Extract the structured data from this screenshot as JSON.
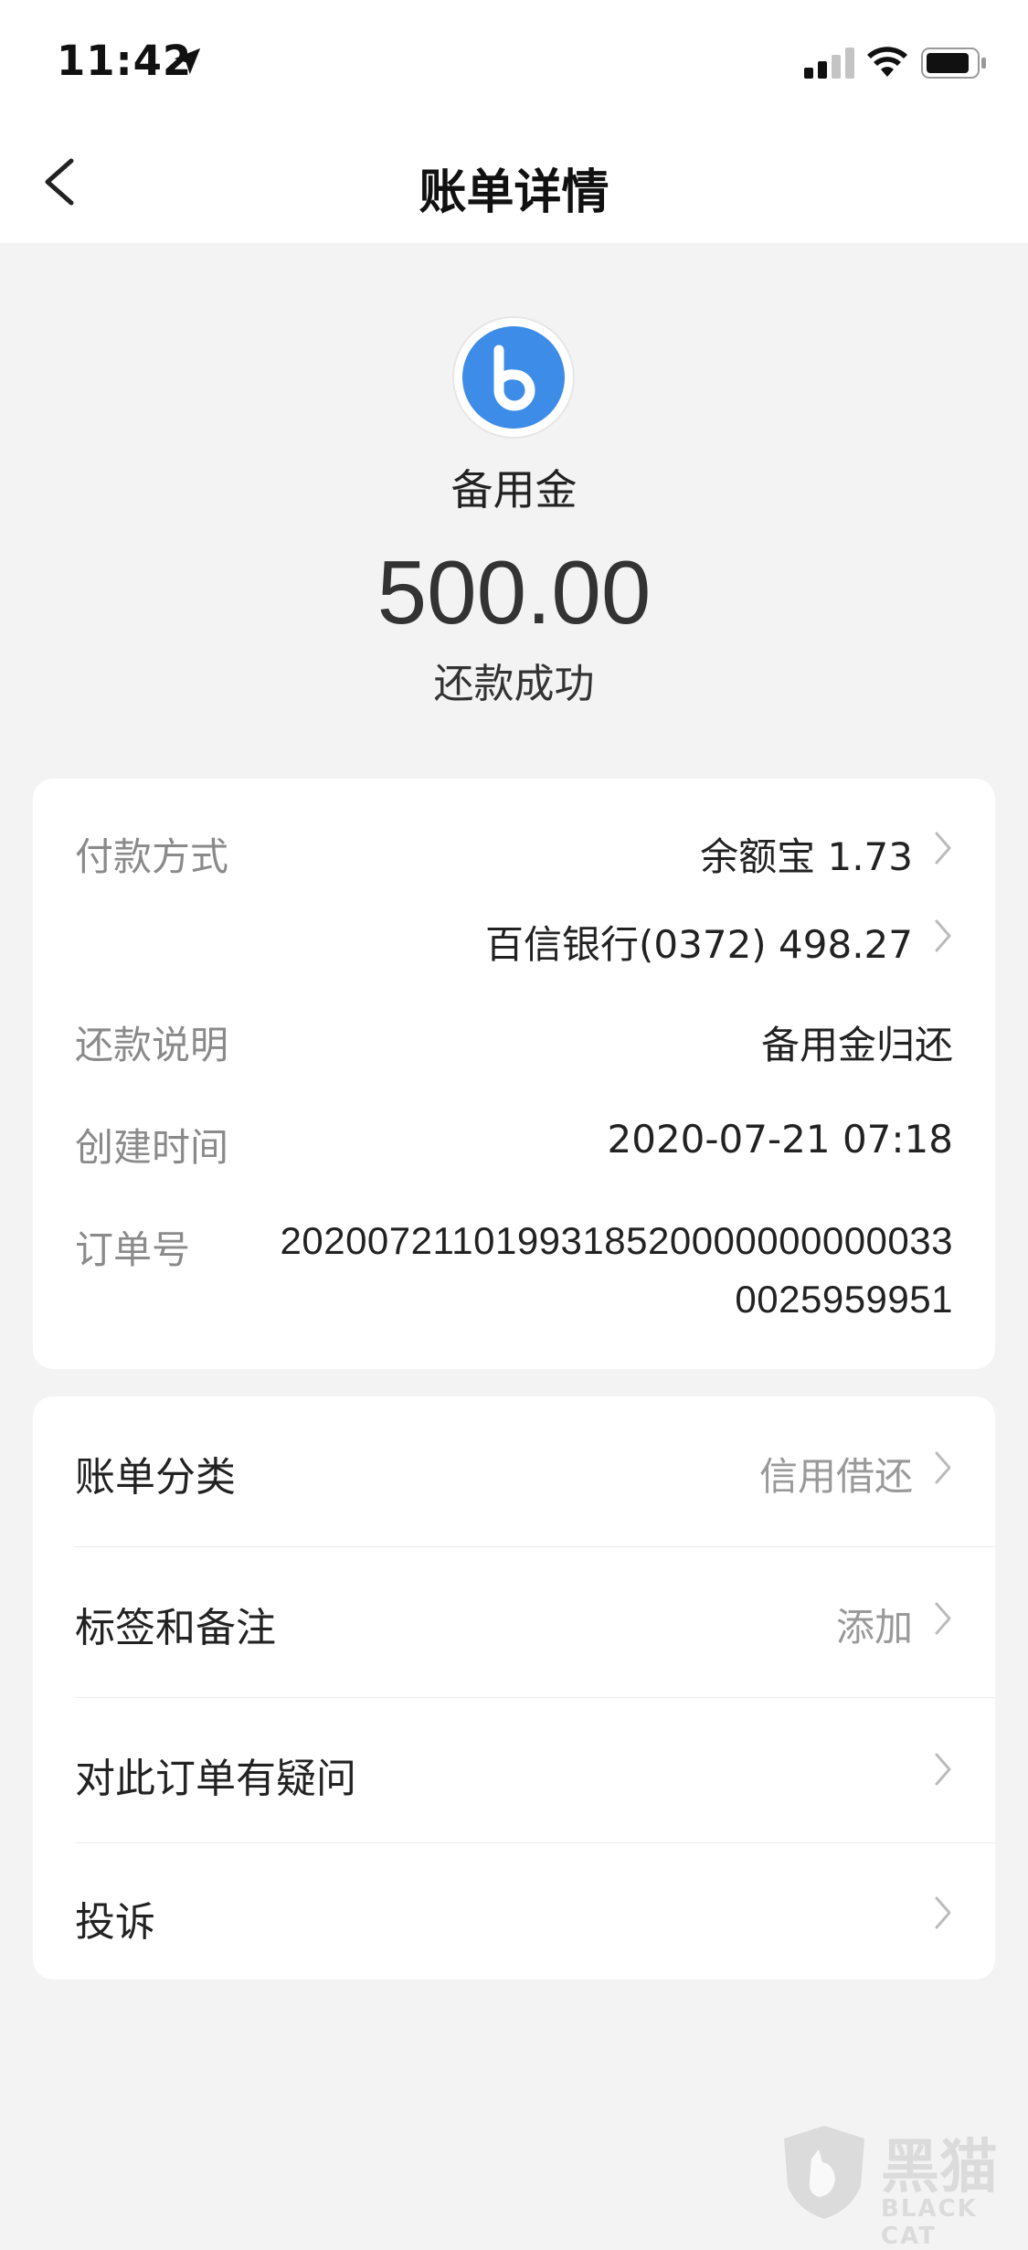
{
  "status_bar": {
    "time": "11:42"
  },
  "nav": {
    "title": "账单详情"
  },
  "header": {
    "product_name": "备用金",
    "amount": "500.00",
    "status": "还款成功",
    "logo_color": "#3d8ce8"
  },
  "details": {
    "payment_method": {
      "label": "付款方式",
      "items": [
        "余额宝 1.73",
        "百信银行(0372) 498.27"
      ]
    },
    "repay_note": {
      "label": "还款说明",
      "value": "备用金归还"
    },
    "created_time": {
      "label": "创建时间",
      "value": "2020-07-21 07:18"
    },
    "order_no": {
      "label": "订单号",
      "line1": "2020072110199318520000000000033",
      "line2": "0025959951"
    }
  },
  "actions": [
    {
      "label": "账单分类",
      "value": "信用借还"
    },
    {
      "label": "标签和备注",
      "value": "添加"
    },
    {
      "label": "对此订单有疑问",
      "value": ""
    },
    {
      "label": "投诉",
      "value": ""
    }
  ],
  "watermark": {
    "text": "黑猫",
    "sub": "BLACK CAT"
  }
}
